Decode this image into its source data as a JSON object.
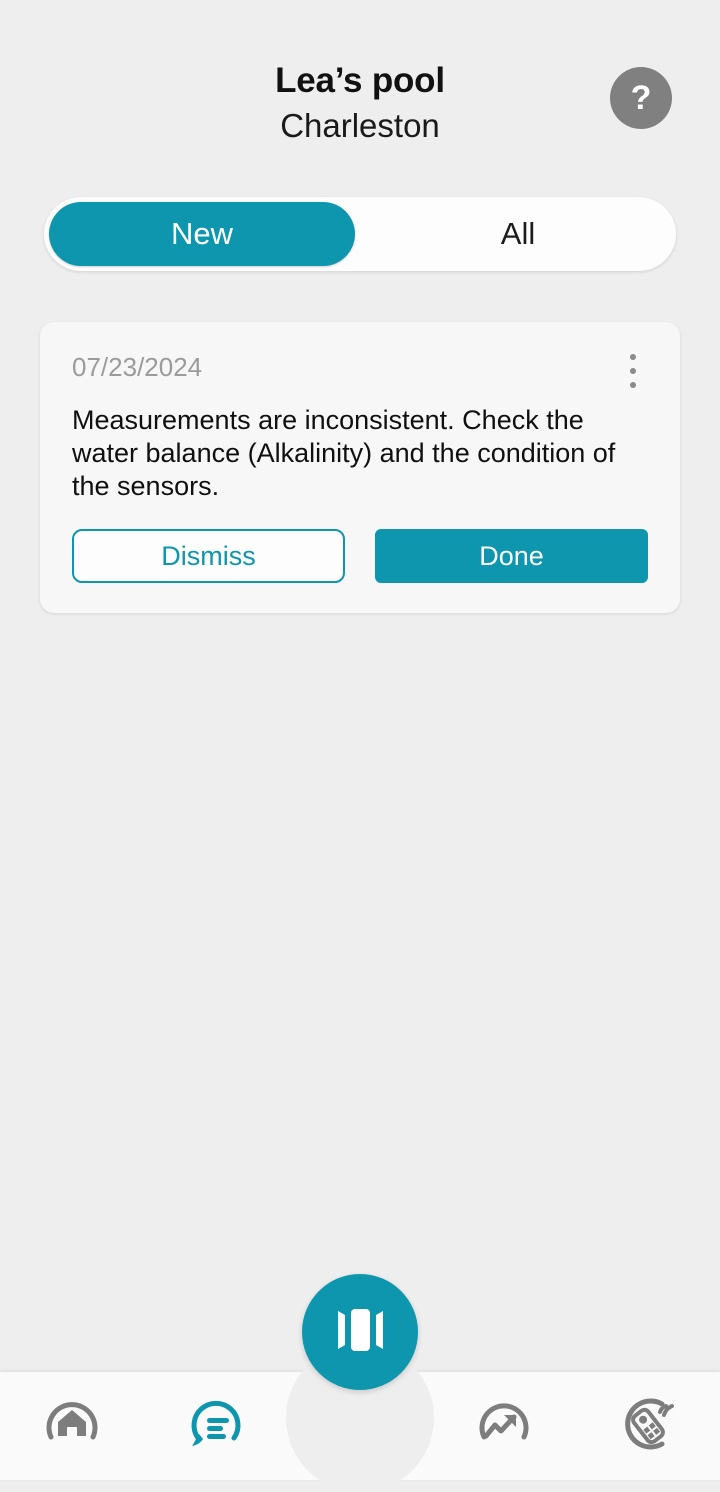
{
  "header": {
    "title": "Lea’s pool",
    "subtitle": "Charleston",
    "help_label": "?"
  },
  "filter_tabs": {
    "items": [
      {
        "label": "New",
        "active": true
      },
      {
        "label": "All",
        "active": false
      }
    ]
  },
  "notification_card": {
    "date": "07/23/2024",
    "message": "Measurements are inconsistent. Check the water balance (Alkalinity) and the condition of the sensors.",
    "dismiss_label": "Dismiss",
    "done_label": "Done",
    "menu_icon": "kebab-menu-icon"
  },
  "bottom_nav": {
    "items": [
      {
        "icon": "home-icon",
        "active": false
      },
      {
        "icon": "messages-icon",
        "active": true
      },
      {
        "icon": "statistics-icon",
        "active": false
      },
      {
        "icon": "remote-control-icon",
        "active": false
      }
    ],
    "fab_icon": "test-strip-icon"
  },
  "colors": {
    "accent": "#0d96ad",
    "page_background": "#eeeeee",
    "card_background": "#f7f7f7",
    "nav_background": "#fafafa",
    "muted_text": "#9b9b9b",
    "inactive_icon": "#7d7d7d",
    "help_button": "#808080"
  }
}
